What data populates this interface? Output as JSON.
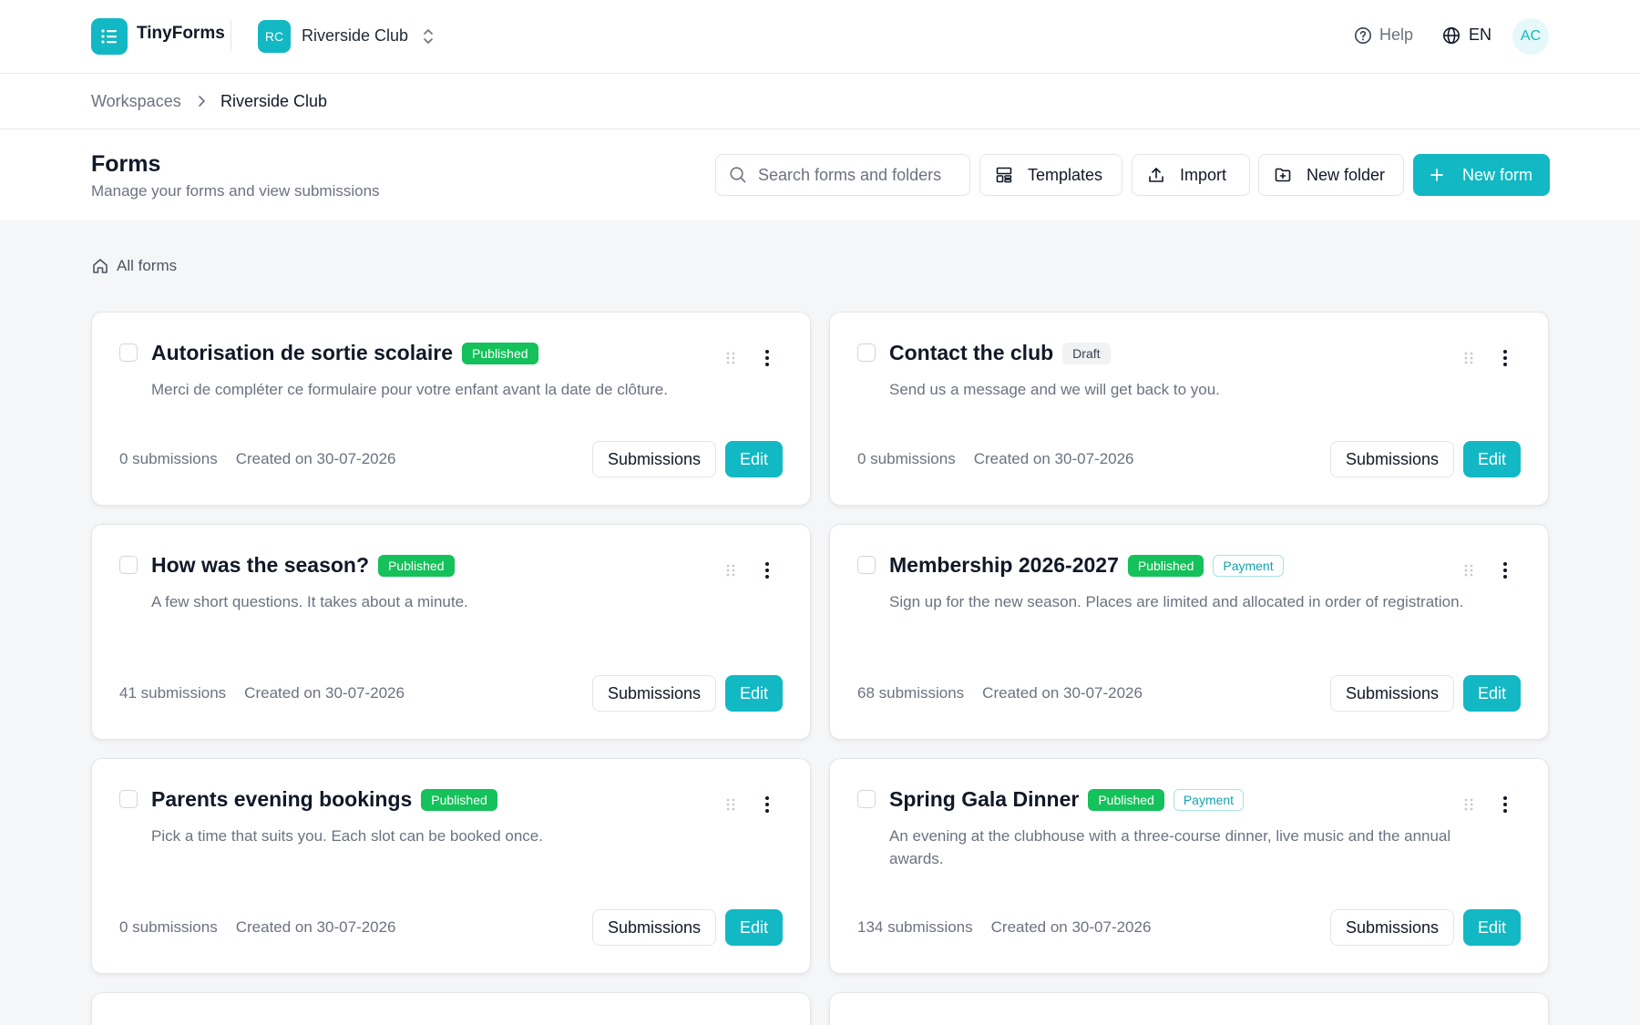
{
  "app": {
    "name": "TinyForms",
    "accent": "#12b8c4"
  },
  "workspace": {
    "initials": "RC",
    "name": "Riverside Club"
  },
  "topbar": {
    "help_label": "Help",
    "lang_label": "EN",
    "user_initials": "AC"
  },
  "breadcrumb": {
    "root": "Workspaces",
    "current": "Riverside Club"
  },
  "header": {
    "title": "Forms",
    "subtitle": "Manage your forms and view submissions",
    "search_placeholder": "Search forms and folders",
    "templates_label": "Templates",
    "import_label": "Import",
    "new_folder_label": "New folder",
    "new_form_label": "New form"
  },
  "folder_path": {
    "label": "All forms"
  },
  "cards": [
    {
      "title": "Autorisation de sortie scolaire",
      "status": "Published",
      "status_type": "published",
      "payment": "",
      "description": "Merci de compléter ce formulaire pour votre enfant avant la date de clôture.",
      "submissions": "0 submissions",
      "created": "Created on 30-07-2026",
      "submissions_btn": "Submissions",
      "edit_btn": "Edit"
    },
    {
      "title": "Contact the club",
      "status": "Draft",
      "status_type": "draft",
      "payment": "",
      "description": "Send us a message and we will get back to you.",
      "submissions": "0 submissions",
      "created": "Created on 30-07-2026",
      "submissions_btn": "Submissions",
      "edit_btn": "Edit"
    },
    {
      "title": "How was the season?",
      "status": "Published",
      "status_type": "published",
      "payment": "",
      "description": "A few short questions. It takes about a minute.",
      "submissions": "41 submissions",
      "created": "Created on 30-07-2026",
      "submissions_btn": "Submissions",
      "edit_btn": "Edit"
    },
    {
      "title": "Membership 2026-2027",
      "status": "Published",
      "status_type": "published",
      "payment": "Payment",
      "description": "Sign up for the new season. Places are limited and allocated in order of registration.",
      "submissions": "68 submissions",
      "created": "Created on 30-07-2026",
      "submissions_btn": "Submissions",
      "edit_btn": "Edit"
    },
    {
      "title": "Parents evening bookings",
      "status": "Published",
      "status_type": "published",
      "payment": "",
      "description": "Pick a time that suits you. Each slot can be booked once.",
      "submissions": "0 submissions",
      "created": "Created on 30-07-2026",
      "submissions_btn": "Submissions",
      "edit_btn": "Edit"
    },
    {
      "title": "Spring Gala Dinner",
      "status": "Published",
      "status_type": "published",
      "payment": "Payment",
      "description": "An evening at the clubhouse with a three-course dinner, live music and the annual awards.",
      "submissions": "134 submissions",
      "created": "Created on 30-07-2026",
      "submissions_btn": "Submissions",
      "edit_btn": "Edit"
    }
  ]
}
